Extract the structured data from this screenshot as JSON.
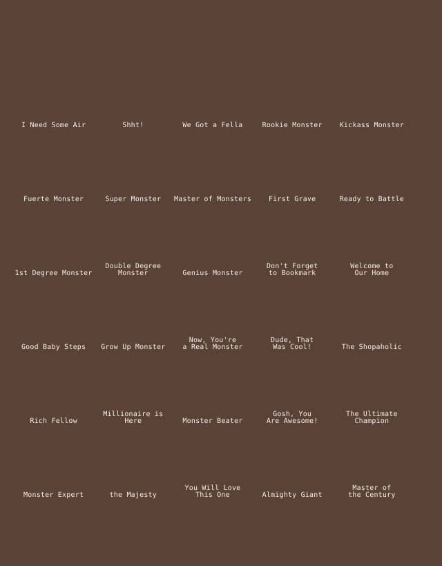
{
  "achievements": [
    "I Need Some Air",
    "Shht!",
    "We Got a Fella",
    "Rookie Monster",
    "Kickass Monster",
    "Fuerte Monster",
    "Super Monster",
    "Master of Monsters",
    "First Grave",
    "Ready to Battle",
    "1st Degree Monster",
    "Double Degree\nMonster",
    "Genius Monster",
    "Don't Forget\nto Bookmark",
    "Welcome to\nOur Home",
    "Good Baby Steps",
    "Grow Up Monster",
    "Now, You're\na Real Monster",
    "Dude, That\nWas Cool!",
    "The Shopaholic",
    "Rich Fellow",
    "Millionaire is Here",
    "Monster Beater",
    "Gosh, You\nAre Awesome!",
    "The Ultimate\nChampion",
    "Monster Expert",
    "the Majesty",
    "You Will Love\nThis One",
    "Almighty Giant",
    "Master of\nthe Century"
  ]
}
